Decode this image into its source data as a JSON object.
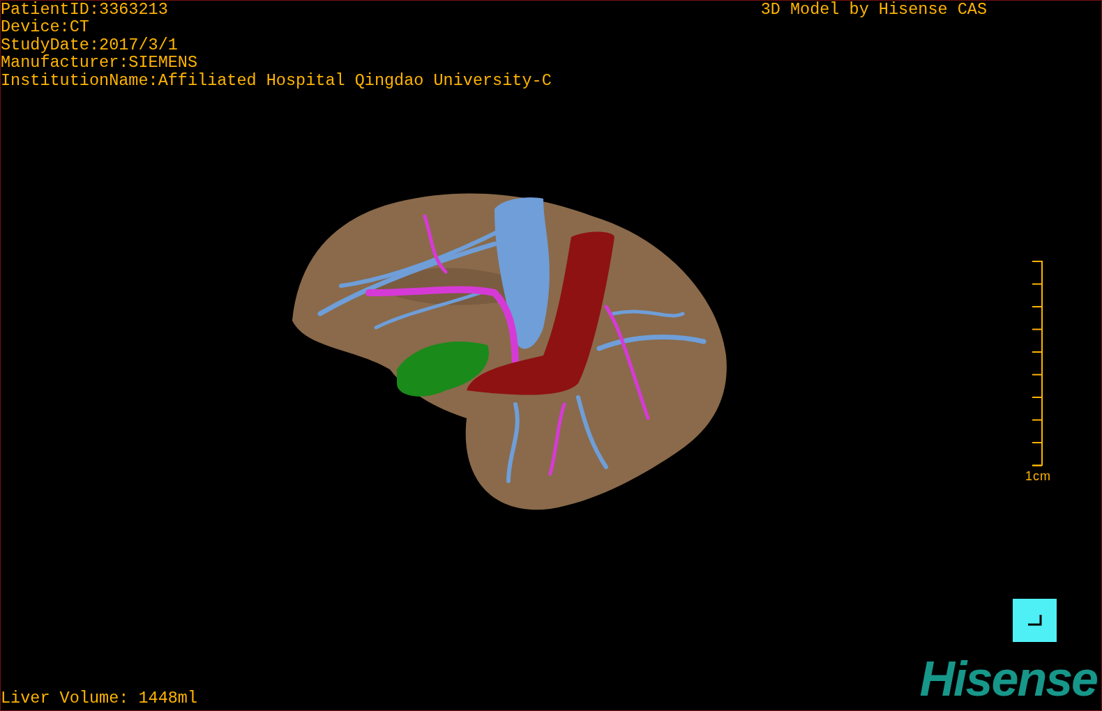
{
  "info_lines": [
    "PatientID:3363213",
    "Device:CT",
    "StudyDate:2017/3/1",
    "Manufacturer:SIEMENS",
    "InstitutionName:Affiliated Hospital Qingdao University-C"
  ],
  "title": "3D Model by Hisense CAS",
  "scale_label": "1cm",
  "liver_volume": "Liver Volume: 1448ml",
  "logo": "Hisense"
}
